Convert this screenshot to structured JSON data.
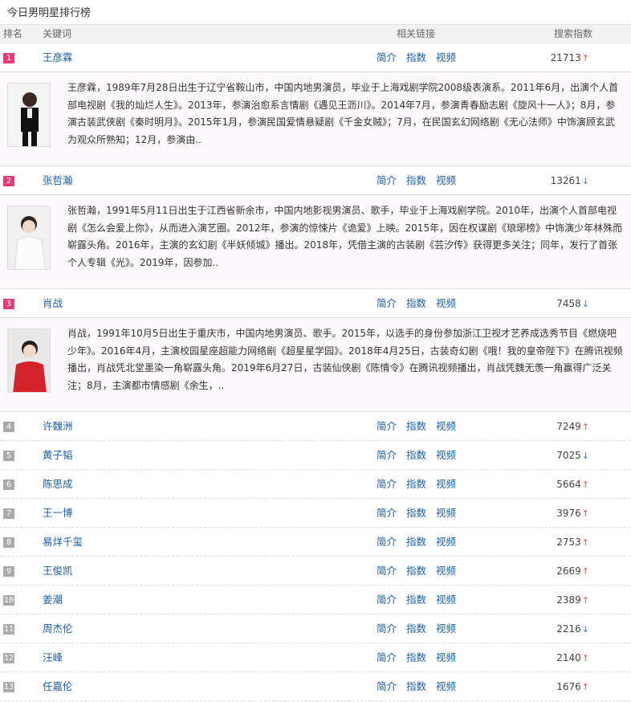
{
  "page_title": "今日男明星排行榜",
  "header": {
    "rank": "排名",
    "keyword": "关键词",
    "links": "相关链接",
    "index": "搜索指数"
  },
  "link_labels": {
    "intro": "简介",
    "index": "指数",
    "video": "视频"
  },
  "rows": [
    {
      "rank": "1",
      "name": "王彦霖",
      "index": "21713",
      "trend": "up",
      "desc": "王彦霖，1989年7月28日出生于辽宁省鞍山市，中国内地男演员，毕业于上海戏剧学院2008级表演系。2011年6月，出演个人首部电视剧《我的灿烂人生》。2013年，参演治愈系言情剧《遇见王沥川》。2014年7月，参演青春励志剧《旋风十一人》；8月，参演古装武侠剧《秦时明月》。2015年1月，参演民国爱情悬疑剧《千金女贼》；7月，在民国玄幻网络剧《无心法师》中饰演顾玄武为观众所熟知；12月，参演由.."
    },
    {
      "rank": "2",
      "name": "张哲瀚",
      "index": "13261",
      "trend": "down",
      "desc": "张哲瀚，1991年5月11日出生于江西省新余市，中国内地影视男演员、歌手，毕业于上海戏剧学院。2010年，出演个人首部电视剧《怎么会爱上你》，从而进入演艺圈。2012年，参演的惊悚片《诡爱》上映。2015年，因在权谋剧《琅琊榜》中饰演少年林殊而崭露头角。2016年，主演的玄幻剧《半妖倾城》播出。2018年，凭借主演的古装剧《芸汐传》获得更多关注；同年，发行了首张个人专辑《光》。2019年，因参加.."
    },
    {
      "rank": "3",
      "name": "肖战",
      "index": "7458",
      "trend": "down",
      "desc": "肖战，1991年10月5日出生于重庆市，中国内地男演员、歌手。2015年，以选手的身份参加浙江卫视才艺养成选秀节目《燃烧吧少年》。2016年4月，主演校园星座超能力网络剧《超星星学园》。2018年4月25日，古装奇幻剧《哦！我的皇帝陛下》在腾讯视频播出，肖战凭北堂墨染一角崭露头角。2019年6月27日，古装仙侠剧《陈情令》在腾讯视频播出，肖战凭魏无羡一角赢得广泛关注；8月，主演都市情感剧《余生，.."
    },
    {
      "rank": "4",
      "name": "许魏洲",
      "index": "7249",
      "trend": "up"
    },
    {
      "rank": "5",
      "name": "黄子韬",
      "index": "7025",
      "trend": "down"
    },
    {
      "rank": "6",
      "name": "陈思成",
      "index": "5664",
      "trend": "up"
    },
    {
      "rank": "7",
      "name": "王一博",
      "index": "3976",
      "trend": "up"
    },
    {
      "rank": "8",
      "name": "易烊千玺",
      "index": "2753",
      "trend": "up"
    },
    {
      "rank": "9",
      "name": "王俊凯",
      "index": "2669",
      "trend": "up"
    },
    {
      "rank": "10",
      "name": "姜潮",
      "index": "2389",
      "trend": "up"
    },
    {
      "rank": "11",
      "name": "周杰伦",
      "index": "2216",
      "trend": "down"
    },
    {
      "rank": "12",
      "name": "汪峰",
      "index": "2140",
      "trend": "up"
    },
    {
      "rank": "13",
      "name": "任嘉伦",
      "index": "1676",
      "trend": "up"
    }
  ],
  "colors": {
    "hot_rank": "#e83a78",
    "rank": "#aaaaaa",
    "link": "#1b5fa8",
    "up": "#e4533a",
    "down": "#3a7ad4"
  },
  "icons": {
    "up": "arrow-up-icon",
    "down": "arrow-down-icon"
  }
}
